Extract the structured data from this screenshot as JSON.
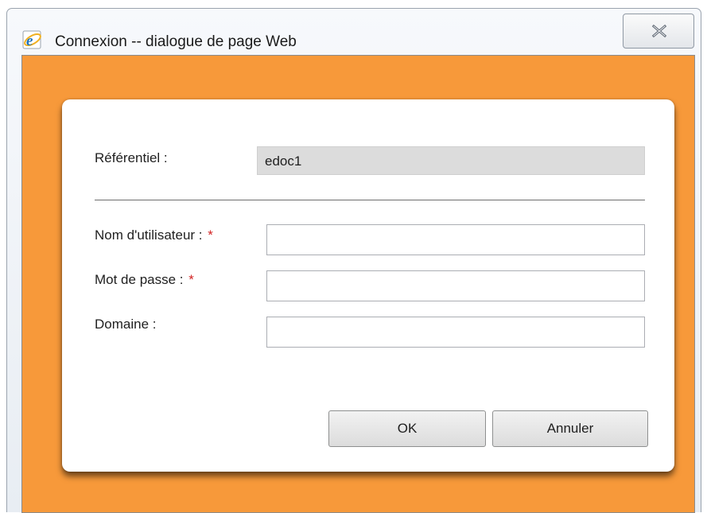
{
  "window": {
    "title": "Connexion -- dialogue de page Web",
    "icon": "internet-explorer-icon",
    "close_icon": "close-icon"
  },
  "colors": {
    "client_background": "#f7993a",
    "panel_background": "#ffffff",
    "readonly_field_background": "#dcdcdc",
    "required_marker": "#d22323"
  },
  "form": {
    "repository": {
      "label": "Référentiel :",
      "value": "edoc1"
    },
    "username": {
      "label": "Nom d'utilisateur :",
      "required_marker": "*",
      "value": ""
    },
    "password": {
      "label": "Mot de passe :",
      "required_marker": "*",
      "value": ""
    },
    "domain": {
      "label": "Domaine :",
      "value": ""
    }
  },
  "buttons": {
    "ok": "OK",
    "cancel": "Annuler"
  }
}
